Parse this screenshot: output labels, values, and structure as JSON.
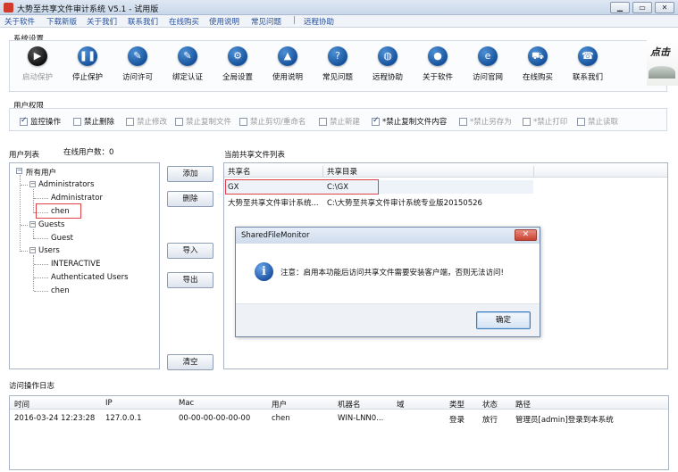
{
  "window": {
    "title": "大势至共享文件审计系统 V5.1 - 试用版",
    "min": "▁",
    "max": "▭",
    "close": "✕"
  },
  "menu": {
    "items": [
      "关于软件",
      "下载新版",
      "关于我们",
      "联系我们",
      "在线购买",
      "使用说明",
      "常见问题"
    ],
    "separator": "|",
    "remote": "远程协助"
  },
  "system": {
    "title": "系统设置",
    "tools": [
      {
        "label": "启动保护",
        "icon": "play-icon",
        "glyph": "▶",
        "disabled": true
      },
      {
        "label": "停止保护",
        "icon": "pause-icon",
        "glyph": "❚❚",
        "disabled": false
      },
      {
        "label": "访问许可",
        "icon": "pen-icon",
        "glyph": "✎",
        "disabled": false
      },
      {
        "label": "绑定认证",
        "icon": "pen-icon",
        "glyph": "✎",
        "disabled": false
      },
      {
        "label": "全局设置",
        "icon": "gear-icon",
        "glyph": "⚙",
        "disabled": false
      },
      {
        "label": "使用说明",
        "icon": "graduation-cap-icon",
        "glyph": "▲",
        "disabled": false
      },
      {
        "label": "常见问题",
        "icon": "question-icon",
        "glyph": "?",
        "disabled": false
      },
      {
        "label": "远程协助",
        "icon": "globe-icon",
        "glyph": "◍",
        "disabled": false
      },
      {
        "label": "关于软件",
        "icon": "user-icon",
        "glyph": "●",
        "disabled": false
      },
      {
        "label": "访问官网",
        "icon": "browser-icon",
        "glyph": "e",
        "disabled": false
      },
      {
        "label": "在线购买",
        "icon": "cart-icon",
        "glyph": "⛟",
        "disabled": false
      },
      {
        "label": "联系我们",
        "icon": "phone-icon",
        "glyph": "☎",
        "disabled": false
      }
    ]
  },
  "logo": {
    "text": "点击"
  },
  "permissions": {
    "title": "用户权限",
    "items": [
      {
        "label": "监控操作",
        "checked": true,
        "enabled": true
      },
      {
        "label": "禁止删除",
        "checked": false,
        "enabled": true
      },
      {
        "label": "禁止修改",
        "checked": false,
        "enabled": false
      },
      {
        "label": "禁止复制文件",
        "checked": false,
        "enabled": false
      },
      {
        "label": "禁止剪切/重命名",
        "checked": false,
        "enabled": false
      },
      {
        "label": "禁止新建",
        "checked": false,
        "enabled": false
      },
      {
        "label": "*禁止复制文件内容",
        "checked": true,
        "enabled": true
      },
      {
        "label": "*禁止另存为",
        "checked": false,
        "enabled": false
      },
      {
        "label": "*禁止打印",
        "checked": false,
        "enabled": false
      },
      {
        "label": "禁止读取",
        "checked": false,
        "enabled": false
      }
    ]
  },
  "users": {
    "title": "用户列表",
    "online_label": "在线用户数：0",
    "tree": {
      "root": "所有用户",
      "admins": "Administrators",
      "admin_user": "Administrator",
      "admin_chen": "chen",
      "guests": "Guests",
      "guest_user": "Guest",
      "users": "Users",
      "interactive": "INTERACTIVE",
      "auth_users": "Authenticated Users",
      "users_chen": "chen"
    }
  },
  "buttons": {
    "add": "添加",
    "delete": "删除",
    "import": "导入",
    "export": "导出",
    "clear": "清空"
  },
  "shares": {
    "title": "当前共享文件列表",
    "columns": [
      "共享名",
      "共享目录"
    ],
    "rows": [
      [
        "GX",
        "C:\\GX"
      ],
      [
        "大势至共享文件审计系统...",
        "C:\\大势至共享文件审计系统专业版20150526"
      ]
    ]
  },
  "dialog": {
    "title": "SharedFileMonitor",
    "close": "✕",
    "message": "注意：启用本功能后访问共享文件需要安装客户端，否则无法访问!",
    "ok": "确定"
  },
  "log": {
    "title": "访问操作日志",
    "columns": [
      "时间",
      "IP",
      "Mac",
      "用户",
      "机器名",
      "域",
      "类型",
      "状态",
      "路径"
    ],
    "rows": [
      [
        "2016-03-24 12:23:28",
        "127.0.0.1",
        "00-00-00-00-00-00",
        "chen",
        "WIN-LNN0...",
        "",
        "登录",
        "放行",
        "管理员[admin]登录到本系统"
      ]
    ]
  }
}
